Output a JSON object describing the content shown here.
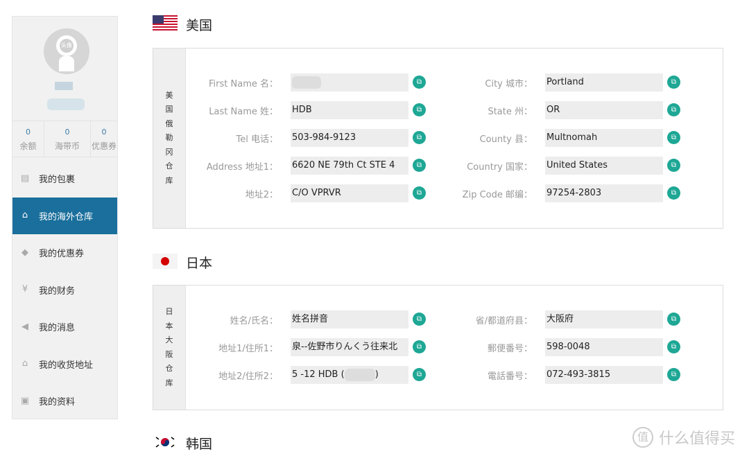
{
  "sidebar": {
    "avatar_text": "头像",
    "stats": [
      {
        "value": "0",
        "label": "余额"
      },
      {
        "value": "0",
        "label": "海带币"
      },
      {
        "value": "0",
        "label": "优惠券"
      }
    ],
    "menu": [
      {
        "label": "我的包裹",
        "icon": "package-icon"
      },
      {
        "label": "我的海外仓库",
        "icon": "home-icon",
        "active": true
      },
      {
        "label": "我的优惠券",
        "icon": "tag-icon"
      },
      {
        "label": "我的财务",
        "icon": "yen-icon"
      },
      {
        "label": "我的消息",
        "icon": "speaker-icon"
      },
      {
        "label": "我的收货地址",
        "icon": "home-icon"
      },
      {
        "label": "我的资料",
        "icon": "id-card-icon"
      }
    ]
  },
  "us": {
    "title": "美国",
    "strip": [
      "美",
      "国",
      "俄",
      "勒",
      "冈",
      "仓",
      "库"
    ],
    "left": [
      {
        "label": "First Name 名：",
        "value": ""
      },
      {
        "label": "Last Name 姓：",
        "value": "HDB"
      },
      {
        "label": "Tel 电话：",
        "value": "503-984-9123"
      },
      {
        "label": "Address 地址1：",
        "value": "6620 NE 79th Ct STE 4"
      },
      {
        "label": "地址2：",
        "value": "C/O VPRVR"
      }
    ],
    "right": [
      {
        "label": "City 城市：",
        "value": "Portland"
      },
      {
        "label": "State 州：",
        "value": "OR"
      },
      {
        "label": "County 县：",
        "value": "Multnomah"
      },
      {
        "label": "Country 国家：",
        "value": "United States"
      },
      {
        "label": "Zip Code 邮编：",
        "value": "97254-2803"
      }
    ]
  },
  "jp": {
    "title": "日本",
    "strip": [
      "日",
      "本",
      "大",
      "阪",
      "仓",
      "库"
    ],
    "left": [
      {
        "label": "姓名/氏名：",
        "value": "姓名拼音"
      },
      {
        "label": "地址1/住所1：",
        "value": "泉--佐野市りんくう往来北"
      },
      {
        "label": "地址2/住所2：",
        "value": "5 -12 HDB (",
        "suffix": ")"
      }
    ],
    "right": [
      {
        "label": "省/都道府县：",
        "value": "大阪府"
      },
      {
        "label": "郵便番号：",
        "value": "598-0048"
      },
      {
        "label": "電話番号：",
        "value": "072-493-3815"
      }
    ]
  },
  "kr": {
    "title": "韩国"
  },
  "watermark": {
    "icon": "值",
    "text": "什么值得买"
  },
  "colors": {
    "accent": "#1a6f9c",
    "copy": "#1ea795"
  }
}
